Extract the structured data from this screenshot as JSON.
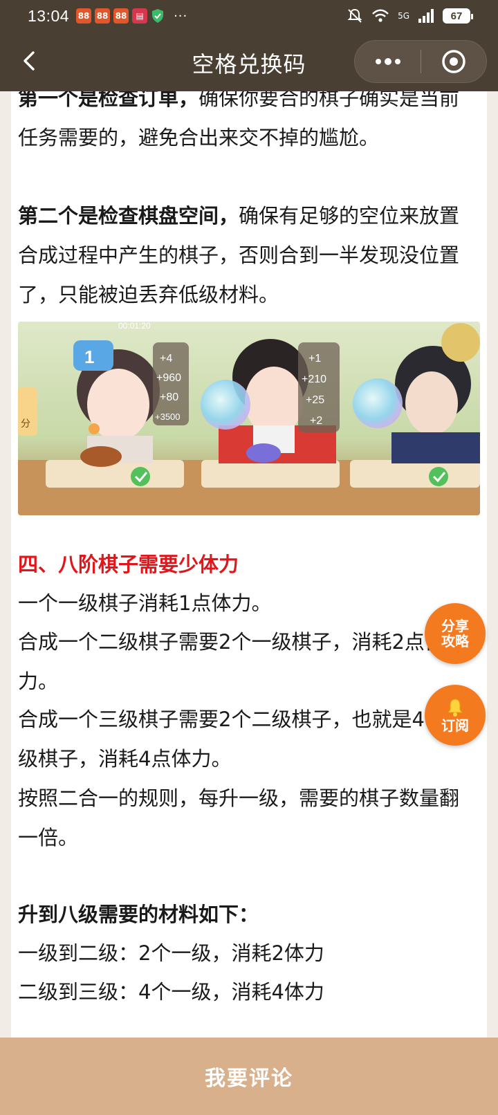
{
  "status_bar": {
    "time": "13:04",
    "app_icons": [
      "app-icon",
      "app-icon",
      "app-icon",
      "app-icon"
    ],
    "network_label": "5G",
    "battery": "67"
  },
  "nav": {
    "title": "空格兑换码"
  },
  "article": {
    "para1_bold": "第一个是检查订单，",
    "para1_text": "确保你要合的棋子确实是当前任务需要的，避免合出来交不掉的尴尬。",
    "para2_bold": "第二个是检查棋盘空间，",
    "para2_text": "确保有足够的空位来放置合成过程中产生的棋子，否则合到一半发现没位置了，只能被迫丢弃低级材料。",
    "image_numbers": [
      "1",
      "+4",
      "+960",
      "+80",
      "+3500",
      "+1",
      "+210",
      "+25",
      "+2",
      "00:01:20",
      "分"
    ],
    "heading": "四、八阶棋子需要少体力",
    "line1": "一个一级棋子消耗1点体力。",
    "line2": "合成一个二级棋子需要2个一级棋子，消耗2点体力。",
    "line3": "合成一个三级棋子需要2个二级棋子，也就是4个一级棋子，消耗4点体力。",
    "line4": "按照二合一的规则，每升一级，需要的棋子数量翻一倍。",
    "materials_heading": "升到八级需要的材料如下：",
    "mat1": "一级到二级：2个一级，消耗2体力",
    "mat2": "二级到三级：4个一级，消耗4体力"
  },
  "floating": {
    "share_line1": "分享",
    "share_line2": "攻略",
    "subscribe": "订阅"
  },
  "bottom_bar": {
    "comment": "我要评论"
  },
  "colors": {
    "header_bg": "#4a3f33",
    "accent_red": "#e0161b",
    "float_orange": "#f47a20",
    "bottom_bar": "#d9b08c"
  }
}
